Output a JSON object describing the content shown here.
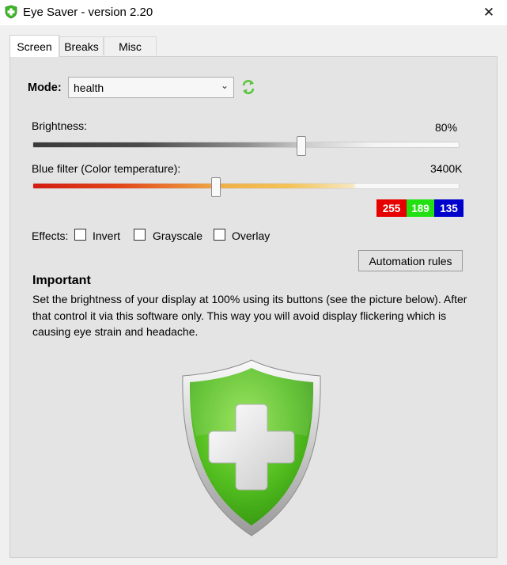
{
  "window": {
    "title": "Eye Saver - version 2.20",
    "close_symbol": "✕"
  },
  "tabs": [
    {
      "label": "Screen",
      "active": true
    },
    {
      "label": "Breaks",
      "active": false
    },
    {
      "label": "Misc",
      "active": false
    }
  ],
  "mode": {
    "label": "Mode:",
    "selected": "health",
    "refresh_icon": "refresh-icon"
  },
  "brightness": {
    "label": "Brightness:",
    "value_text": "80%",
    "value_fraction": 0.63
  },
  "blue_filter": {
    "label": "Blue filter (Color temperature):",
    "value_text": "3400K",
    "value_fraction": 0.43,
    "rgb": {
      "r": "255",
      "g": "189",
      "b": "135"
    }
  },
  "effects": {
    "label": "Effects:",
    "options": [
      {
        "label": "Invert",
        "checked": false
      },
      {
        "label": "Grayscale",
        "checked": false
      },
      {
        "label": "Overlay",
        "checked": false
      }
    ]
  },
  "automation_button": "Automation rules",
  "important": {
    "title": "Important",
    "text": "Set the brightness of your display at 100% using its buttons (see the picture below). After that control it via this software only. This way you will avoid display flickering which is causing eye strain and headache."
  },
  "colors": {
    "accent_green": "#4cc42a",
    "red": "#e60000",
    "green": "#22e011",
    "blue": "#0000cc"
  }
}
